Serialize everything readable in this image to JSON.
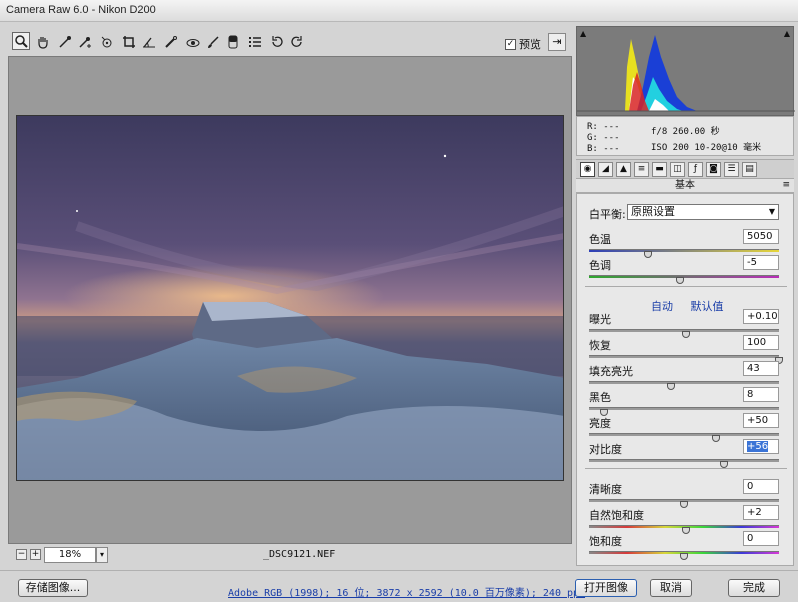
{
  "window": {
    "title": "Camera Raw 6.0 -  Nikon D200"
  },
  "toolbar": {
    "tools": [
      "zoom-icon",
      "hand-icon",
      "white-balance-icon",
      "color-sampler-icon",
      "target-adjust-icon",
      "crop-icon",
      "straighten-icon",
      "spot-removal-icon",
      "red-eye-icon",
      "adjustment-brush-icon",
      "graduated-filter-icon",
      "preferences-icon",
      "rotate-ccw-icon",
      "rotate-cw-icon"
    ],
    "preview_label": "预览",
    "preview_checked": "✓",
    "exit_glyph": "⇥"
  },
  "image": {
    "filename": "_DSC9121.NEF"
  },
  "statusbar": {
    "zoom_minus": "−",
    "zoom_plus": "+",
    "zoom": "18%",
    "zoom_caret": "▾"
  },
  "info": {
    "r": "R:  ---",
    "g": "G:  ---",
    "b": "B:  ---",
    "aperture_shutter": "f/8  260.00 秒",
    "iso_lens": "ISO 200   10-20@10 毫米"
  },
  "tabs": [
    "basic-tab",
    "tone-curve-tab",
    "detail-tab",
    "hsl-tab",
    "split-toning-tab",
    "lens-tab",
    "effects-tab",
    "camera-calibration-tab",
    "presets-tab",
    "snapshots-tab"
  ],
  "panel": {
    "title": "基本",
    "menu": "≡",
    "white_balance_label": "白平衡:",
    "white_balance_value": "原照设置",
    "auto_label": "自动",
    "default_label": "默认值",
    "controls": [
      {
        "label": "色温",
        "value": "5050",
        "level": 0.31
      },
      {
        "label": "色调",
        "value": "-5",
        "level": 0.48
      },
      {
        "label": "曝光",
        "value": "+0.10",
        "level": 0.51
      },
      {
        "label": "恢复",
        "value": "100",
        "level": 1.0
      },
      {
        "label": "填充亮光",
        "value": "43",
        "level": 0.43
      },
      {
        "label": "黑色",
        "value": "8",
        "level": 0.08
      },
      {
        "label": "亮度",
        "value": "+50",
        "level": 0.67
      },
      {
        "label": "对比度",
        "value": "+56",
        "level": 0.71
      },
      {
        "label": "清晰度",
        "value": "0",
        "level": 0.5
      },
      {
        "label": "自然饱和度",
        "value": "+2",
        "level": 0.51
      },
      {
        "label": "饱和度",
        "value": "0",
        "level": 0.5
      }
    ]
  },
  "bottom": {
    "save_label": "存储图像...",
    "workflow": "Adobe RGB (1998); 16 位;  3872 x 2592 (10.0 百万像素); 240 ppi",
    "open_label": "打开图像",
    "cancel_label": "取消",
    "done_label": "完成"
  },
  "colors": {
    "link": "#1a3ea8",
    "selection": "#3b74d6"
  }
}
